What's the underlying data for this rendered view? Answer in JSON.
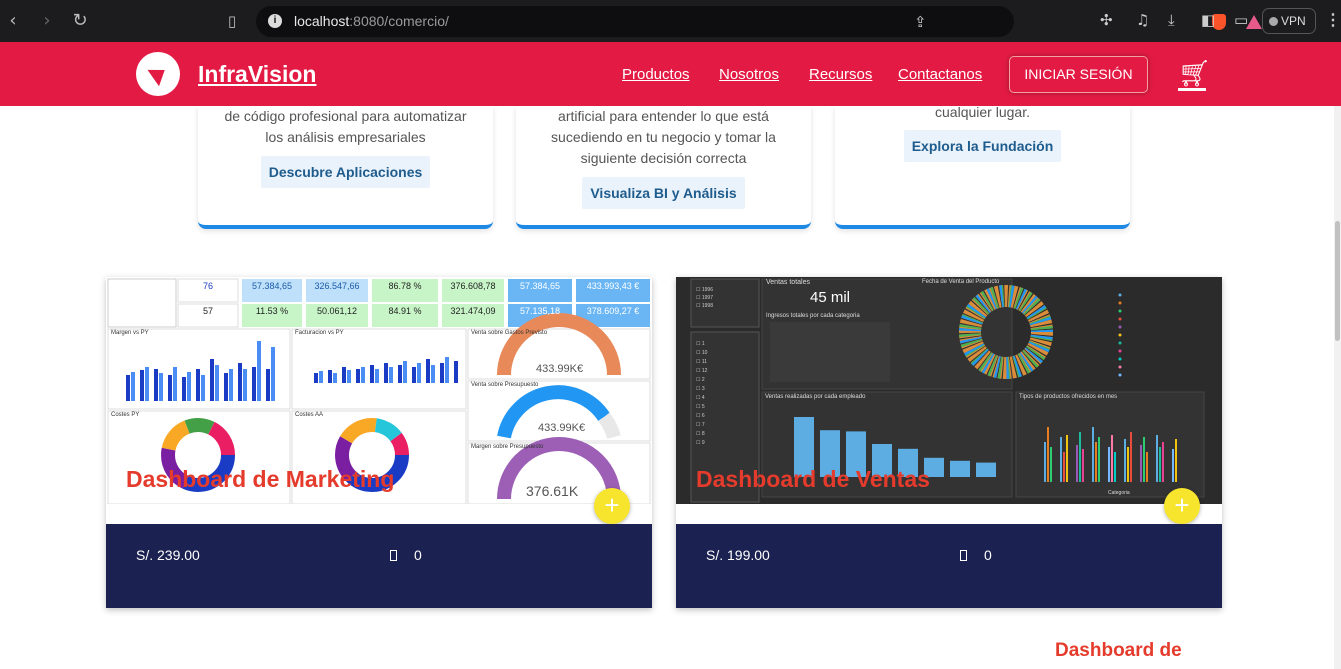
{
  "browser": {
    "url_host": "localhost",
    "url_rest": ":8080/comercio/",
    "vpn_label": "VPN"
  },
  "header": {
    "brand": "InfraVision",
    "nav": [
      "Productos",
      "Nosotros",
      "Recursos",
      "Contactanos"
    ],
    "login": "INICIAR SESIÓN",
    "cart_icon": "cart-icon"
  },
  "info_cards": [
    {
      "lines": [
        "de código profesional para automatizar",
        "los análisis empresariales"
      ],
      "cta": "Descubre Aplicaciones"
    },
    {
      "lines": [
        "artificial para entender lo que está",
        "sucediendo en tu negocio y tomar la",
        "siguiente decisión correcta"
      ],
      "cta": "Visualiza BI y Análisis"
    },
    {
      "lines": [
        "cualquier lugar."
      ],
      "cta": "Explora la Fundación"
    }
  ],
  "products": [
    {
      "title": "Dashboard de Marketing",
      "price": "S/. 239.00",
      "count": "0",
      "kpis": [
        "76",
        "57.384,65",
        "326.547,66",
        "86.78 %",
        "376.608,78",
        "57.384,65",
        "433.993,43 €",
        "57",
        "11.53 %",
        "50.061,12",
        "84.91 %",
        "321.474,09",
        "57.135,18",
        "378.609,27 €"
      ],
      "panels": [
        "Margen vs PY",
        "Facturacion vs PY",
        "Venta sobre Gastos Previsto",
        "Costes PY",
        "Costes AA",
        "Venta sobre Presupuesto",
        "Margen sobre Presupuesto"
      ],
      "gauges": [
        "433.99K€",
        "433.99K€",
        "376.61K"
      ]
    },
    {
      "title": "Dashboard de Ventas",
      "price": "S/. 199.00",
      "count": "0",
      "labels": [
        "Ventas totales",
        "45 mil",
        "Fecha de Venta del Producto",
        "Ingresos totales por cada categoria",
        "Ventas realizadas por cada empleado",
        "Tipos de productos ofrecidos en mes",
        "Categoria"
      ],
      "years": [
        "1996",
        "1997",
        "1998"
      ],
      "months": [
        "1",
        "10",
        "11",
        "12",
        "2",
        "3",
        "4",
        "5",
        "6",
        "7",
        "8",
        "9"
      ],
      "employee_bars": [
        100,
        78,
        76,
        55,
        47,
        32,
        27,
        24
      ]
    }
  ],
  "bottom_title": "Dashboard de"
}
